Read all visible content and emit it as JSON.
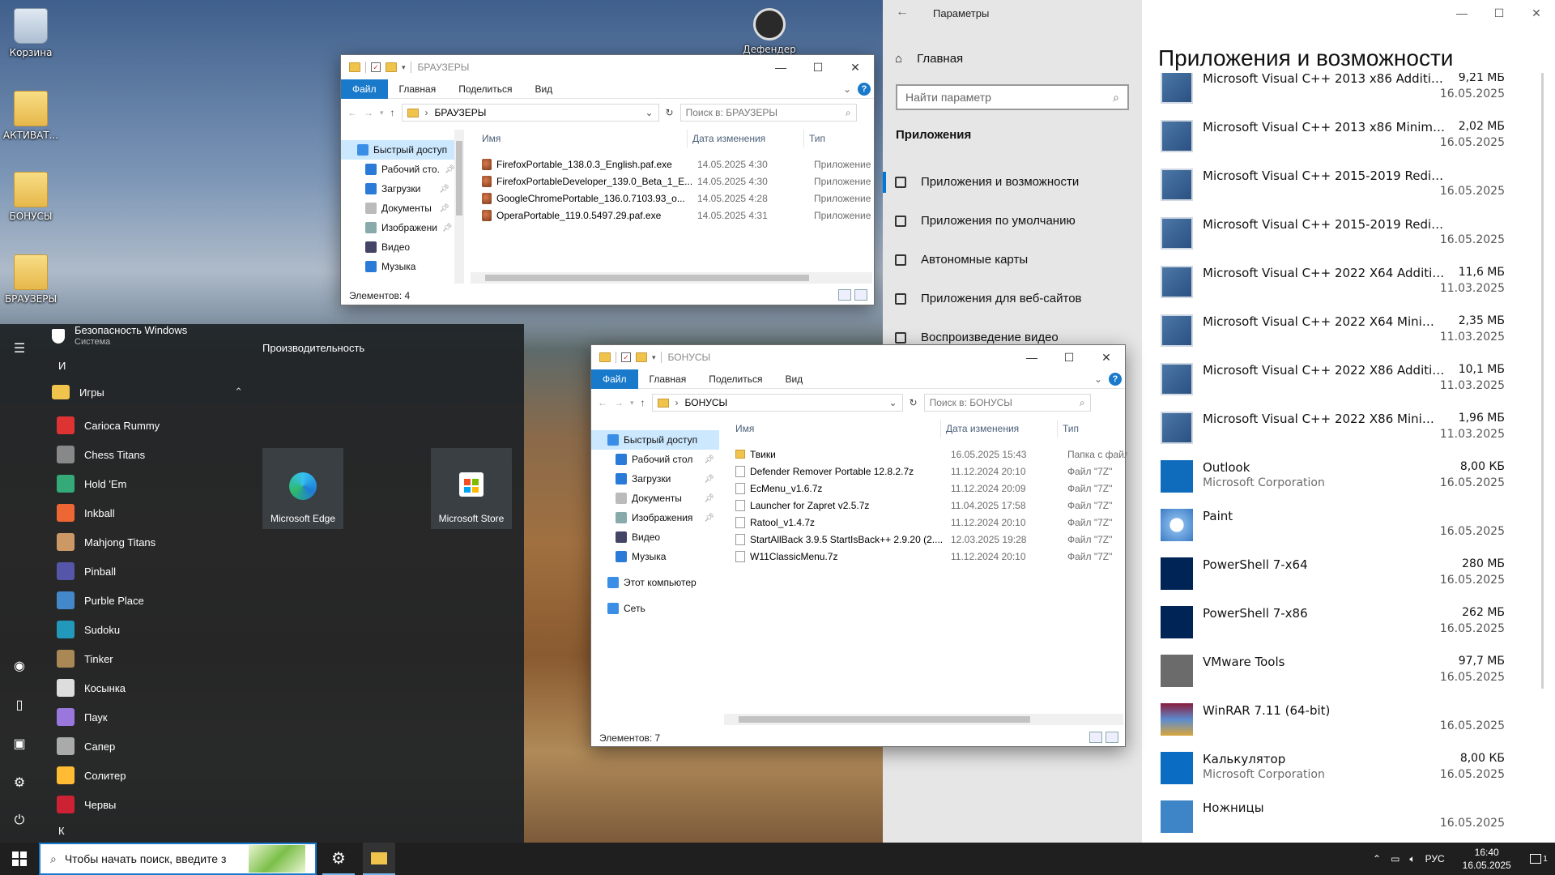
{
  "desktop": {
    "icons": [
      {
        "label": "Корзина"
      },
      {
        "label": "АКТИВАТ..."
      },
      {
        "label": "БОНУСЫ"
      },
      {
        "label": "БРАУЗЕРЫ"
      }
    ],
    "partial_icon_label": "Дефендер"
  },
  "explorer1": {
    "title": "БРАУЗЕРЫ",
    "ribbon": [
      "Файл",
      "Главная",
      "Поделиться",
      "Вид"
    ],
    "address": "БРАУЗЕРЫ",
    "search_placeholder": "Поиск в: БРАУЗЕРЫ",
    "nav": [
      "Быстрый доступ",
      "Рабочий сто.",
      "Загрузки",
      "Документы",
      "Изображени",
      "Видео",
      "Музыка"
    ],
    "columns": [
      "Имя",
      "Дата изменения",
      "Тип"
    ],
    "files": [
      {
        "name": "FirefoxPortable_138.0.3_English.paf.exe",
        "date": "14.05.2025 4:30",
        "type": "Приложение"
      },
      {
        "name": "FirefoxPortableDeveloper_139.0_Beta_1_E...",
        "date": "14.05.2025 4:30",
        "type": "Приложение"
      },
      {
        "name": "GoogleChromePortable_136.0.7103.93_o...",
        "date": "14.05.2025 4:28",
        "type": "Приложение"
      },
      {
        "name": "OperaPortable_119.0.5497.29.paf.exe",
        "date": "14.05.2025 4:31",
        "type": "Приложение"
      }
    ],
    "status": "Элементов: 4"
  },
  "explorer2": {
    "title": "БОНУСЫ",
    "ribbon": [
      "Файл",
      "Главная",
      "Поделиться",
      "Вид"
    ],
    "address": "БОНУСЫ",
    "search_placeholder": "Поиск в: БОНУСЫ",
    "nav": [
      "Быстрый доступ",
      "Рабочий стол",
      "Загрузки",
      "Документы",
      "Изображения",
      "Видео",
      "Музыка",
      "Этот компьютер",
      "Сеть"
    ],
    "columns": [
      "Имя",
      "Дата изменения",
      "Тип"
    ],
    "files": [
      {
        "name": "Твики",
        "date": "16.05.2025 15:43",
        "type": "Папка с файл",
        "kind": "folder"
      },
      {
        "name": "Defender Remover Portable 12.8.2.7z",
        "date": "11.12.2024 20:10",
        "type": "Файл \"7Z\""
      },
      {
        "name": "EcMenu_v1.6.7z",
        "date": "11.12.2024 20:09",
        "type": "Файл \"7Z\""
      },
      {
        "name": "Launcher for Zapret v2.5.7z",
        "date": "11.04.2025 17:58",
        "type": "Файл \"7Z\""
      },
      {
        "name": "Ratool_v1.4.7z",
        "date": "11.12.2024 20:10",
        "type": "Файл \"7Z\""
      },
      {
        "name": "StartAllBack 3.9.5 StartIsBack++ 2.9.20 (2....",
        "date": "12.03.2025 19:28",
        "type": "Файл \"7Z\""
      },
      {
        "name": "W11ClassicMenu.7z",
        "date": "11.12.2024 20:10",
        "type": "Файл \"7Z\""
      }
    ],
    "status": "Элементов: 7"
  },
  "settings": {
    "window_title": "Параметры",
    "home": "Главная",
    "search_placeholder": "Найти параметр",
    "section": "Приложения",
    "nav": [
      "Приложения и возможности",
      "Приложения по умолчанию",
      "Автономные карты",
      "Приложения для веб-сайтов",
      "Воспроизведение видео"
    ],
    "heading": "Приложения и возможности",
    "apps": [
      {
        "name": "Microsoft Visual C++ 2013 x86 Additional Runt...",
        "size": "9,21 МБ",
        "date": "16.05.2025",
        "icon": "vcpp"
      },
      {
        "name": "Microsoft Visual C++ 2013 x86 Minimum Runt...",
        "size": "2,02 МБ",
        "date": "16.05.2025",
        "icon": "vcpp"
      },
      {
        "name": "Microsoft Visual C++ 2015-2019 Redistributabl...",
        "size": "",
        "date": "16.05.2025",
        "icon": "vcpp"
      },
      {
        "name": "Microsoft Visual C++ 2015-2019 Redistributabl...",
        "size": "",
        "date": "16.05.2025",
        "icon": "vcpp"
      },
      {
        "name": "Microsoft Visual C++ 2022 X64 Additional Run...",
        "size": "11,6 МБ",
        "date": "11.03.2025",
        "icon": "vcpp"
      },
      {
        "name": "Microsoft Visual C++ 2022 X64 Minimum Runt...",
        "size": "2,35 МБ",
        "date": "11.03.2025",
        "icon": "vcpp"
      },
      {
        "name": "Microsoft Visual C++ 2022 X86 Additional Run...",
        "size": "10,1 МБ",
        "date": "11.03.2025",
        "icon": "vcpp"
      },
      {
        "name": "Microsoft Visual C++ 2022 X86 Minimum Runt...",
        "size": "1,96 МБ",
        "date": "11.03.2025",
        "icon": "vcpp"
      },
      {
        "name": "Outlook",
        "publisher": "Microsoft Corporation",
        "size": "8,00 КБ",
        "date": "16.05.2025",
        "icon": "outlook"
      },
      {
        "name": "Paint",
        "size": "",
        "date": "16.05.2025",
        "icon": "paint"
      },
      {
        "name": "PowerShell 7-x64",
        "size": "280 МБ",
        "date": "16.05.2025",
        "icon": "ps"
      },
      {
        "name": "PowerShell 7-x86",
        "size": "262 МБ",
        "date": "16.05.2025",
        "icon": "ps"
      },
      {
        "name": "VMware Tools",
        "size": "97,7 МБ",
        "date": "16.05.2025",
        "icon": "vm"
      },
      {
        "name": "WinRAR 7.11 (64-bit)",
        "size": "",
        "date": "16.05.2025",
        "icon": "rar"
      },
      {
        "name": "Калькулятор",
        "publisher": "Microsoft Corporation",
        "size": "8,00 КБ",
        "date": "16.05.2025",
        "icon": "calc"
      },
      {
        "name": "Ножницы",
        "size": "",
        "date": "16.05.2025",
        "icon": "snip"
      }
    ]
  },
  "start": {
    "top_item": "Безопасность Windows",
    "top_sub": "Система",
    "letter_i": "И",
    "group": "Игры",
    "games": [
      "Carioca Rummy",
      "Chess Titans",
      "Hold 'Em",
      "Inkball",
      "Mahjong Titans",
      "Pinball",
      "Purble Place",
      "Sudoku",
      "Tinker",
      "Косынка",
      "Паук",
      "Сапер",
      "Солитер",
      "Червы"
    ],
    "letter_k": "К",
    "tiles_header": "Производительность",
    "tiles": [
      "Microsoft Edge",
      "Microsoft Store"
    ]
  },
  "taskbar": {
    "search_placeholder": "Чтобы начать поиск, введите з",
    "lang": "РУС",
    "time": "16:40",
    "date": "16.05.2025",
    "notif_count": "1"
  }
}
